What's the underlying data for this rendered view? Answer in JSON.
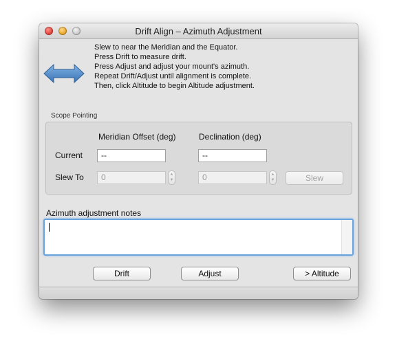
{
  "window": {
    "title": "Drift Align – Azimuth Adjustment"
  },
  "instructions": [
    "Slew to near the Meridian and the Equator.",
    "Press Drift to measure drift.",
    "Press Adjust and adjust your mount's azimuth.",
    "Repeat Drift/Adjust until alignment is complete.",
    "Then, click Altitude to begin Altitude adjustment."
  ],
  "scope_pointing": {
    "group_label": "Scope Pointing",
    "col_meridian": "Meridian Offset (deg)",
    "col_declination": "Declination (deg)",
    "current_label": "Current",
    "slew_to_label": "Slew To",
    "current_meridian": "--",
    "current_declination": "--",
    "slew_meridian": "0",
    "slew_declination": "0",
    "slew_button": "Slew"
  },
  "notes": {
    "label": "Azimuth adjustment notes",
    "value": ""
  },
  "buttons": {
    "drift": "Drift",
    "adjust": "Adjust",
    "altitude": "> Altitude"
  },
  "icons": {
    "arrow": "left-right-arrow-icon"
  },
  "colors": {
    "arrow_fill": "#4a86c5",
    "focus_ring": "#6aa2dd"
  }
}
